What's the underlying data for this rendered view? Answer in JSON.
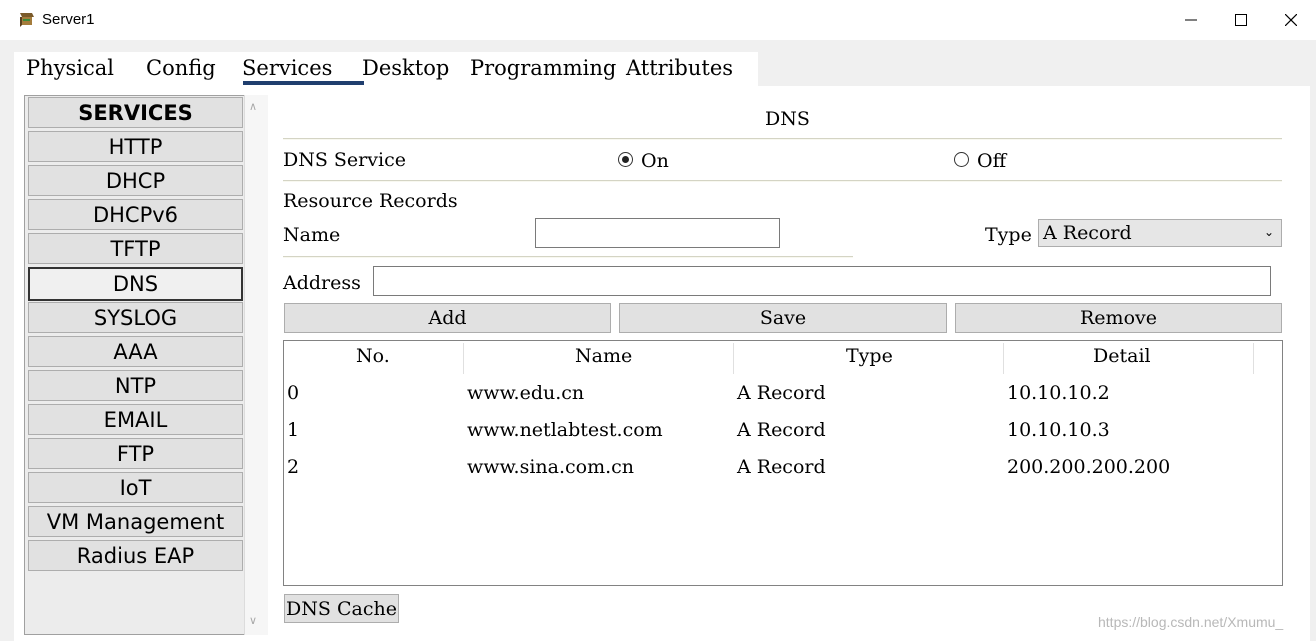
{
  "window": {
    "title": "Server1",
    "minimize_icon": "minimize-icon",
    "maximize_icon": "maximize-icon",
    "close_icon": "close-icon"
  },
  "tabs": [
    "Physical",
    "Config",
    "Services",
    "Desktop",
    "Programming",
    "Attributes"
  ],
  "active_tab": "Services",
  "services": {
    "header": "SERVICES",
    "items": [
      "HTTP",
      "DHCP",
      "DHCPv6",
      "TFTP",
      "DNS",
      "SYSLOG",
      "AAA",
      "NTP",
      "EMAIL",
      "FTP",
      "IoT",
      "VM Management",
      "Radius EAP"
    ],
    "selected": "DNS"
  },
  "dns": {
    "section_title": "DNS",
    "service_label": "DNS Service",
    "on_label": "On",
    "off_label": "Off",
    "service_state": "On",
    "records_label": "Resource Records",
    "name_label": "Name",
    "name_value": "",
    "type_label": "Type",
    "type_value": "A Record",
    "address_label": "Address",
    "address_value": "",
    "add_label": "Add",
    "save_label": "Save",
    "remove_label": "Remove",
    "cache_label": "DNS Cache"
  },
  "table": {
    "headers": [
      "No.",
      "Name",
      "Type",
      "Detail"
    ],
    "rows": [
      [
        "0",
        "www.edu.cn",
        "A Record",
        "10.10.10.2"
      ],
      [
        "1",
        "www.netlabtest.com",
        "A Record",
        "10.10.10.3"
      ],
      [
        "2",
        "www.sina.com.cn",
        "A Record",
        "200.200.200.200"
      ]
    ]
  },
  "watermark": "https://blog.csdn.net/Xmumu_"
}
